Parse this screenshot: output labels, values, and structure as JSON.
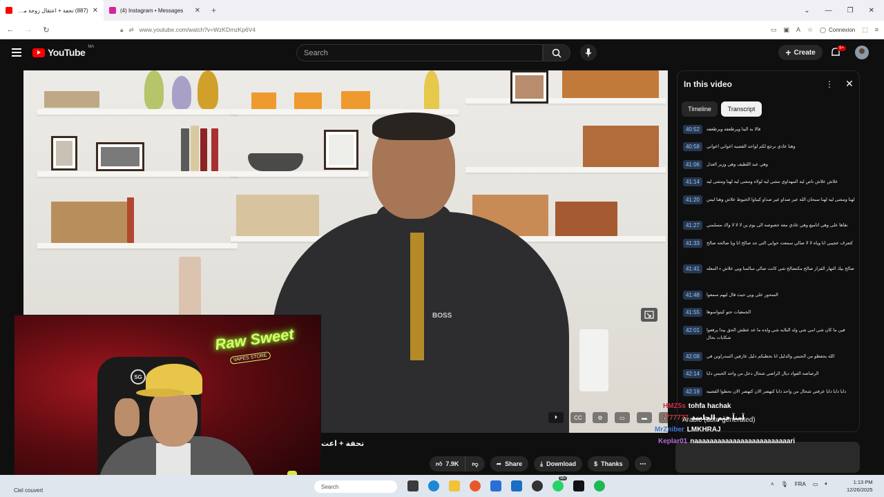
{
  "browser": {
    "tabs": [
      {
        "title": "(887) تحفة + اعتقال زوجة مهدي",
        "active": true,
        "favicon_color": "#ff0000"
      },
      {
        "title": "(4) Instagram • Messages",
        "active": false,
        "favicon_color": "#d6249f"
      }
    ],
    "new_tab_label": "+",
    "url": "www.youtube.com/watch?v=WzKDmzKp6V4",
    "connexion_label": "Connexion"
  },
  "youtube": {
    "logo_text": "YouTube",
    "country_code": "MA",
    "search_placeholder": "Search",
    "create_label": "Create",
    "notification_count": "9+"
  },
  "video": {
    "title_fragment": "تحفة + اعت",
    "shirt_brand": "BOSS"
  },
  "panel": {
    "title": "In this video",
    "tabs": {
      "timeline": "Timeline",
      "transcript": "Transcript"
    },
    "segments": [
      {
        "time": "40:52",
        "text": "فالا به الينا ويرطعفه ويرطعفه"
      },
      {
        "time": "40:58",
        "text": "وهنا عادي نرجع لكم لواحد القصيه اعواني اعواني"
      },
      {
        "time": "41:06",
        "text": "وهي عبد اللطيف وهي وزير العدل"
      },
      {
        "time": "41:14",
        "text": "علاش علاش ناص ليه المهداوي مشى ليه لولاه ومشى ليه لهنا ومشى ليه"
      },
      {
        "time": "41:20",
        "text": "لهنا ومشى ليه لهنا سبحان الله عير صداو عير صداو كيباوا الخيوط علاش وهنا ليس"
      },
      {
        "time": "41:27",
        "text": "نقاها على وهي اتاميع وهي عادي معه خصوصه الى يوم ين لا لا لا واك مسلمني"
      },
      {
        "time": "41:33",
        "text": "كتعرف عجيبي انا وياه لا لا صالي سمعت خوابي التي جد صالح انا ويا صالحه صالح"
      },
      {
        "time": "41:41",
        "text": "صالح بيك النهار الفراز صالح مكتصالح شي كانت صالي سالمنا ويي علاش ء المعله"
      },
      {
        "time": "41:48",
        "text": "السحور على ويي حيث قال ليهم سمعوا"
      },
      {
        "time": "41:55",
        "text": "الجمعيات حتو كيتواسوها"
      },
      {
        "time": "42:01",
        "text": "فين ما كان شي امي شي ولد البلايه شي ولده ما عد عطش الحق بيدا يرفعوا شكايات بحال"
      },
      {
        "time": "42:08",
        "text": "الله يحفظو من الحبس والدليل انا نحطيكم دليل عارفين السدراوين في"
      },
      {
        "time": "42:14",
        "text": "الرصاصه الفواد ديال الراضي شحال دخل من واحد الحبس دابا"
      },
      {
        "time": "42:19",
        "text": "دابا دابا دابا عرفتي شحال من واحد دابا كتهضر الان كتهضر الان نحطوا القصيه"
      }
    ]
  },
  "chat": {
    "caption_language": "Arabic (auto-generated)",
    "messages": [
      {
        "user": "HMZ5s",
        "text": "tohfa hachak"
      },
      {
        "user": "7777777",
        "text": "آمنآ ختم الجلسة"
      },
      {
        "user": "MrZniber",
        "text": "LMKHRAJ"
      },
      {
        "user": "Keplar01",
        "text": "naaaaaaaaaaaaaaaaaaaaaaaaari"
      }
    ]
  },
  "actions": {
    "likes": "7.9K",
    "share": "Share",
    "download": "Download",
    "thanks": "Thanks",
    "more": "⋯"
  },
  "stream_overlay": {
    "neon_text": "Raw Sweet",
    "neon_sub": "VAPES STORE",
    "chair_logo": "SG"
  },
  "taskbar": {
    "weather": "Ciel couvert",
    "search_placeholder": "Search",
    "language": "FRA",
    "time": "1:13 PM",
    "date": "12/26/2025",
    "whatsapp_badge": "99+"
  }
}
